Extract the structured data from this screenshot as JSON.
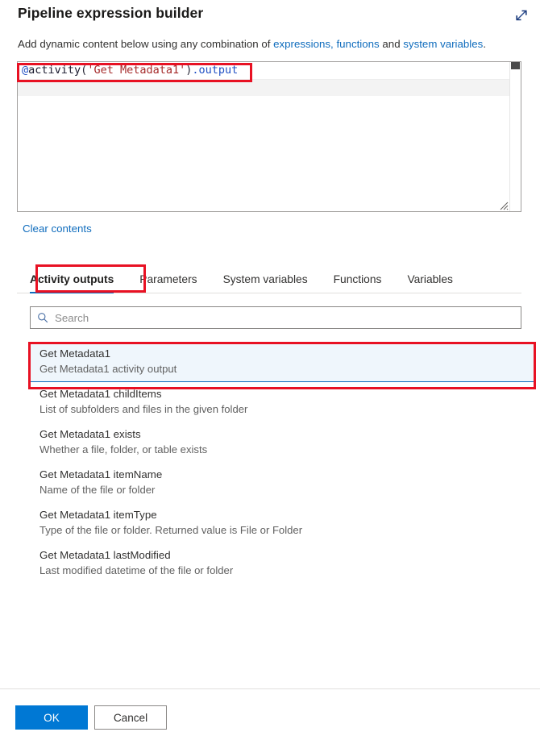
{
  "header": {
    "title": "Pipeline expression builder",
    "expand_icon": "expand-diagonal-arrows-icon"
  },
  "subtitle": {
    "lead": "Add dynamic content below using any combination of ",
    "link_expressions": "expressions,",
    "sep1": " ",
    "link_functions": "functions",
    "mid": " and ",
    "link_system_variables": "system variables",
    "tail": "."
  },
  "editor": {
    "expression": "@activity('Get Metadata1').output",
    "tokens": {
      "at": "@",
      "func": "activity",
      "open_paren": "(",
      "string": "'Get Metadata1'",
      "close_paren": ")",
      "property": ".output"
    },
    "scrollbar": "vertical-scrollbar",
    "resize_grip": "resize-grip-icon"
  },
  "clear_contents_label": "Clear contents",
  "tabs": [
    {
      "label": "Activity outputs",
      "active": true
    },
    {
      "label": "Parameters",
      "active": false
    },
    {
      "label": "System variables",
      "active": false
    },
    {
      "label": "Functions",
      "active": false
    },
    {
      "label": "Variables",
      "active": false
    }
  ],
  "search": {
    "placeholder": "Search",
    "value": "",
    "icon": "search-magnifier-icon"
  },
  "output_list": [
    {
      "title": "Get Metadata1",
      "description": "Get Metadata1 activity output",
      "selected": true
    },
    {
      "title": "Get Metadata1 childItems",
      "description": "List of subfolders and files in the given folder",
      "selected": false
    },
    {
      "title": "Get Metadata1 exists",
      "description": "Whether a file, folder, or table exists",
      "selected": false
    },
    {
      "title": "Get Metadata1 itemName",
      "description": "Name of the file or folder",
      "selected": false
    },
    {
      "title": "Get Metadata1 itemType",
      "description": "Type of the file or folder. Returned value is File or Folder",
      "selected": false
    },
    {
      "title": "Get Metadata1 lastModified",
      "description": "Last modified datetime of the file or folder",
      "selected": false
    }
  ],
  "footer": {
    "ok_label": "OK",
    "cancel_label": "Cancel"
  },
  "colors": {
    "accent": "#0078d4",
    "link": "#0f6cbd",
    "annotation": "#e81123",
    "selected_row_bg": "#eff6fc",
    "string_token": "#a52a2a",
    "keyword_token": "#1f4fc4"
  }
}
